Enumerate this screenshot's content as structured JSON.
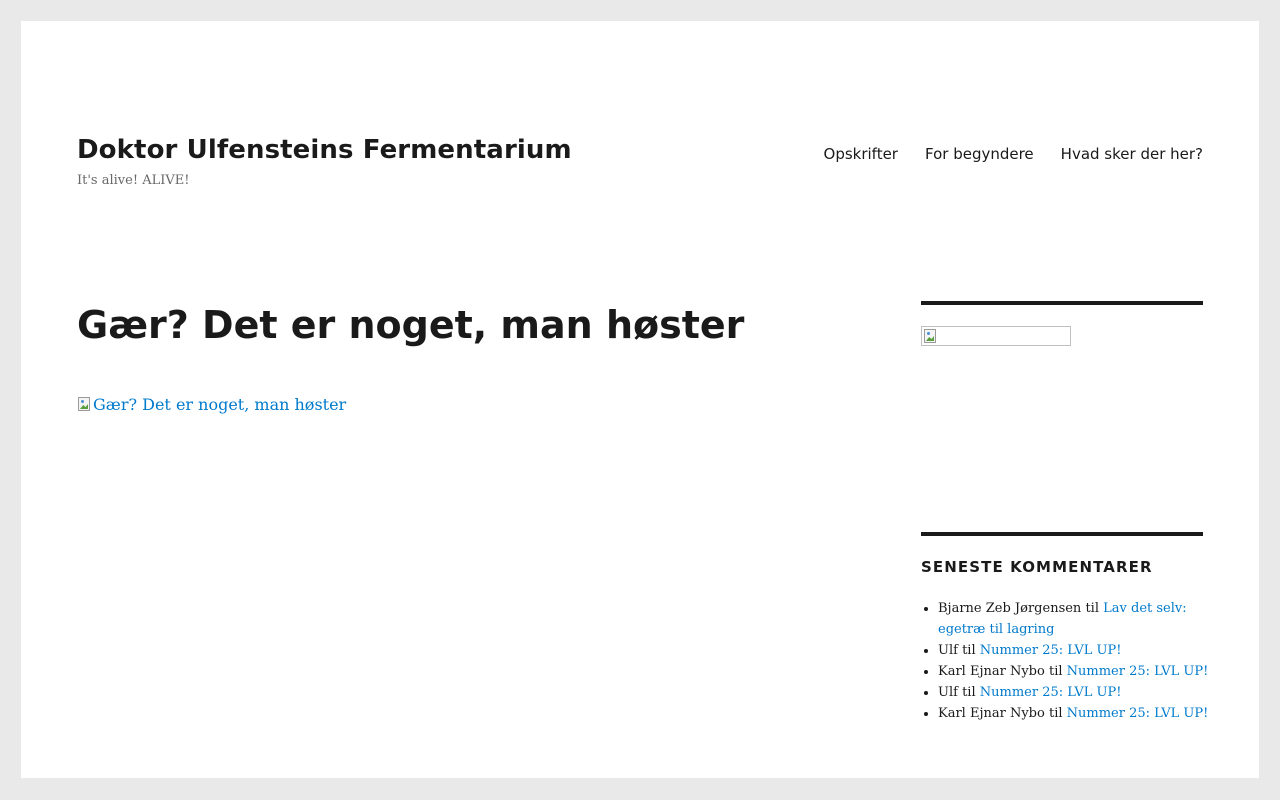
{
  "site": {
    "title": "Doktor Ulfensteins Fermentarium",
    "tagline": "It's alive! ALIVE!"
  },
  "nav": {
    "items": [
      {
        "label": "Opskrifter"
      },
      {
        "label": "For begyndere"
      },
      {
        "label": "Hvad sker der her?"
      }
    ]
  },
  "post": {
    "title": "Gær? Det er noget, man høster",
    "image_alt": "Gær? Det er noget, man høster"
  },
  "sidebar": {
    "image_icon": "broken-image-icon",
    "recent_comments": {
      "title": "SENESTE KOMMENTARER",
      "items": [
        {
          "author": "Bjarne Zeb Jørgensen",
          "connector": "til",
          "post": "Lav det selv: egetræ til lagring"
        },
        {
          "author": "Ulf",
          "connector": "til",
          "post": "Nummer 25: LVL UP!"
        },
        {
          "author": "Karl Ejnar Nybo",
          "connector": "til",
          "post": "Nummer 25: LVL UP!"
        },
        {
          "author": "Ulf",
          "connector": "til",
          "post": "Nummer 25: LVL UP!"
        },
        {
          "author": "Karl Ejnar Nybo",
          "connector": "til",
          "post": "Nummer 25: LVL UP!"
        }
      ]
    }
  },
  "colors": {
    "background": "#e9e9e9",
    "page": "#ffffff",
    "text": "#1a1a1a",
    "muted": "#686868",
    "link": "#007acc"
  }
}
